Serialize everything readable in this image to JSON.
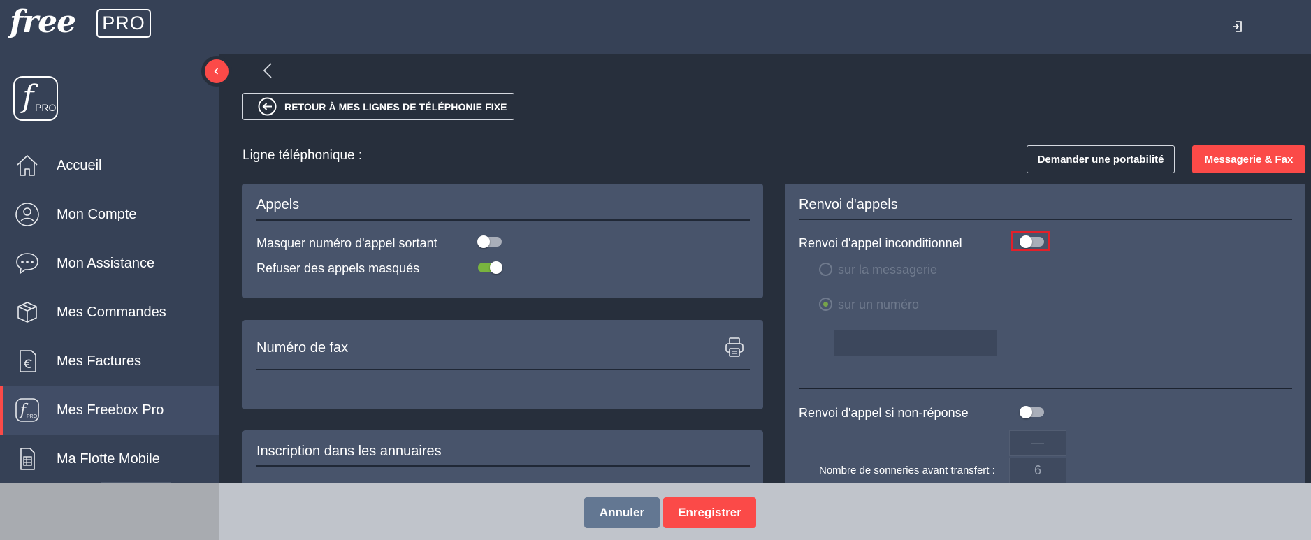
{
  "colors": {
    "topbar": "#364156",
    "background": "#272f3c",
    "card": "#48546b",
    "accent": "#fb4a48",
    "toggle_on": "#79b43e",
    "highlight": "#e3202a",
    "footer": "#c0c4cb",
    "cancel_button": "#637792"
  },
  "header": {
    "logo_free": "free",
    "logo_pro": "PRO",
    "logout_icon": "logout-icon"
  },
  "sidebar": {
    "logo_letter": "f",
    "logo_sub": "PRO",
    "items": [
      {
        "label": "Accueil",
        "icon": "home-icon",
        "active": false
      },
      {
        "label": "Mon Compte",
        "icon": "user-icon",
        "active": false
      },
      {
        "label": "Mon Assistance",
        "icon": "chat-icon",
        "active": false
      },
      {
        "label": "Mes Commandes",
        "icon": "box-icon",
        "active": false
      },
      {
        "label": "Mes Factures",
        "icon": "invoice-euro-icon",
        "active": false
      },
      {
        "label": "Mes Freebox Pro",
        "icon": "freebox-pro-icon",
        "active": true
      },
      {
        "label": "Ma Flotte Mobile",
        "icon": "sim-card-icon",
        "active": false
      }
    ]
  },
  "main": {
    "back_button_label": "RETOUR À MES LIGNES DE TÉLÉPHONIE FIXE",
    "line_title": "Ligne téléphonique :",
    "portability_button": "Demander une portabilité",
    "messagerie_button": "Messagerie & Fax",
    "appels": {
      "title": "Appels",
      "masquer_label": "Masquer numéro d'appel sortant",
      "masquer_on": false,
      "refuser_label": "Refuser des appels masqués",
      "refuser_on": true
    },
    "fax": {
      "title": "Numéro de fax",
      "value": ""
    },
    "annuaires": {
      "title": "Inscription dans les annuaires"
    },
    "renvoi": {
      "title": "Renvoi d'appels",
      "inconditionnel_label": "Renvoi d'appel inconditionnel",
      "inconditionnel_on": false,
      "option_messagerie": "sur la messagerie",
      "option_numero": "sur un numéro",
      "selected_option": "sur un numéro",
      "numero_value": "",
      "non_reponse_label": "Renvoi d'appel si non-réponse",
      "non_reponse_on": false,
      "stepper_minus": "—",
      "sonneries_label": "Nombre de sonneries avant transfert :",
      "sonneries_value": "6"
    }
  },
  "footer": {
    "cancel_label": "Annuler",
    "save_label": "Enregistrer"
  }
}
